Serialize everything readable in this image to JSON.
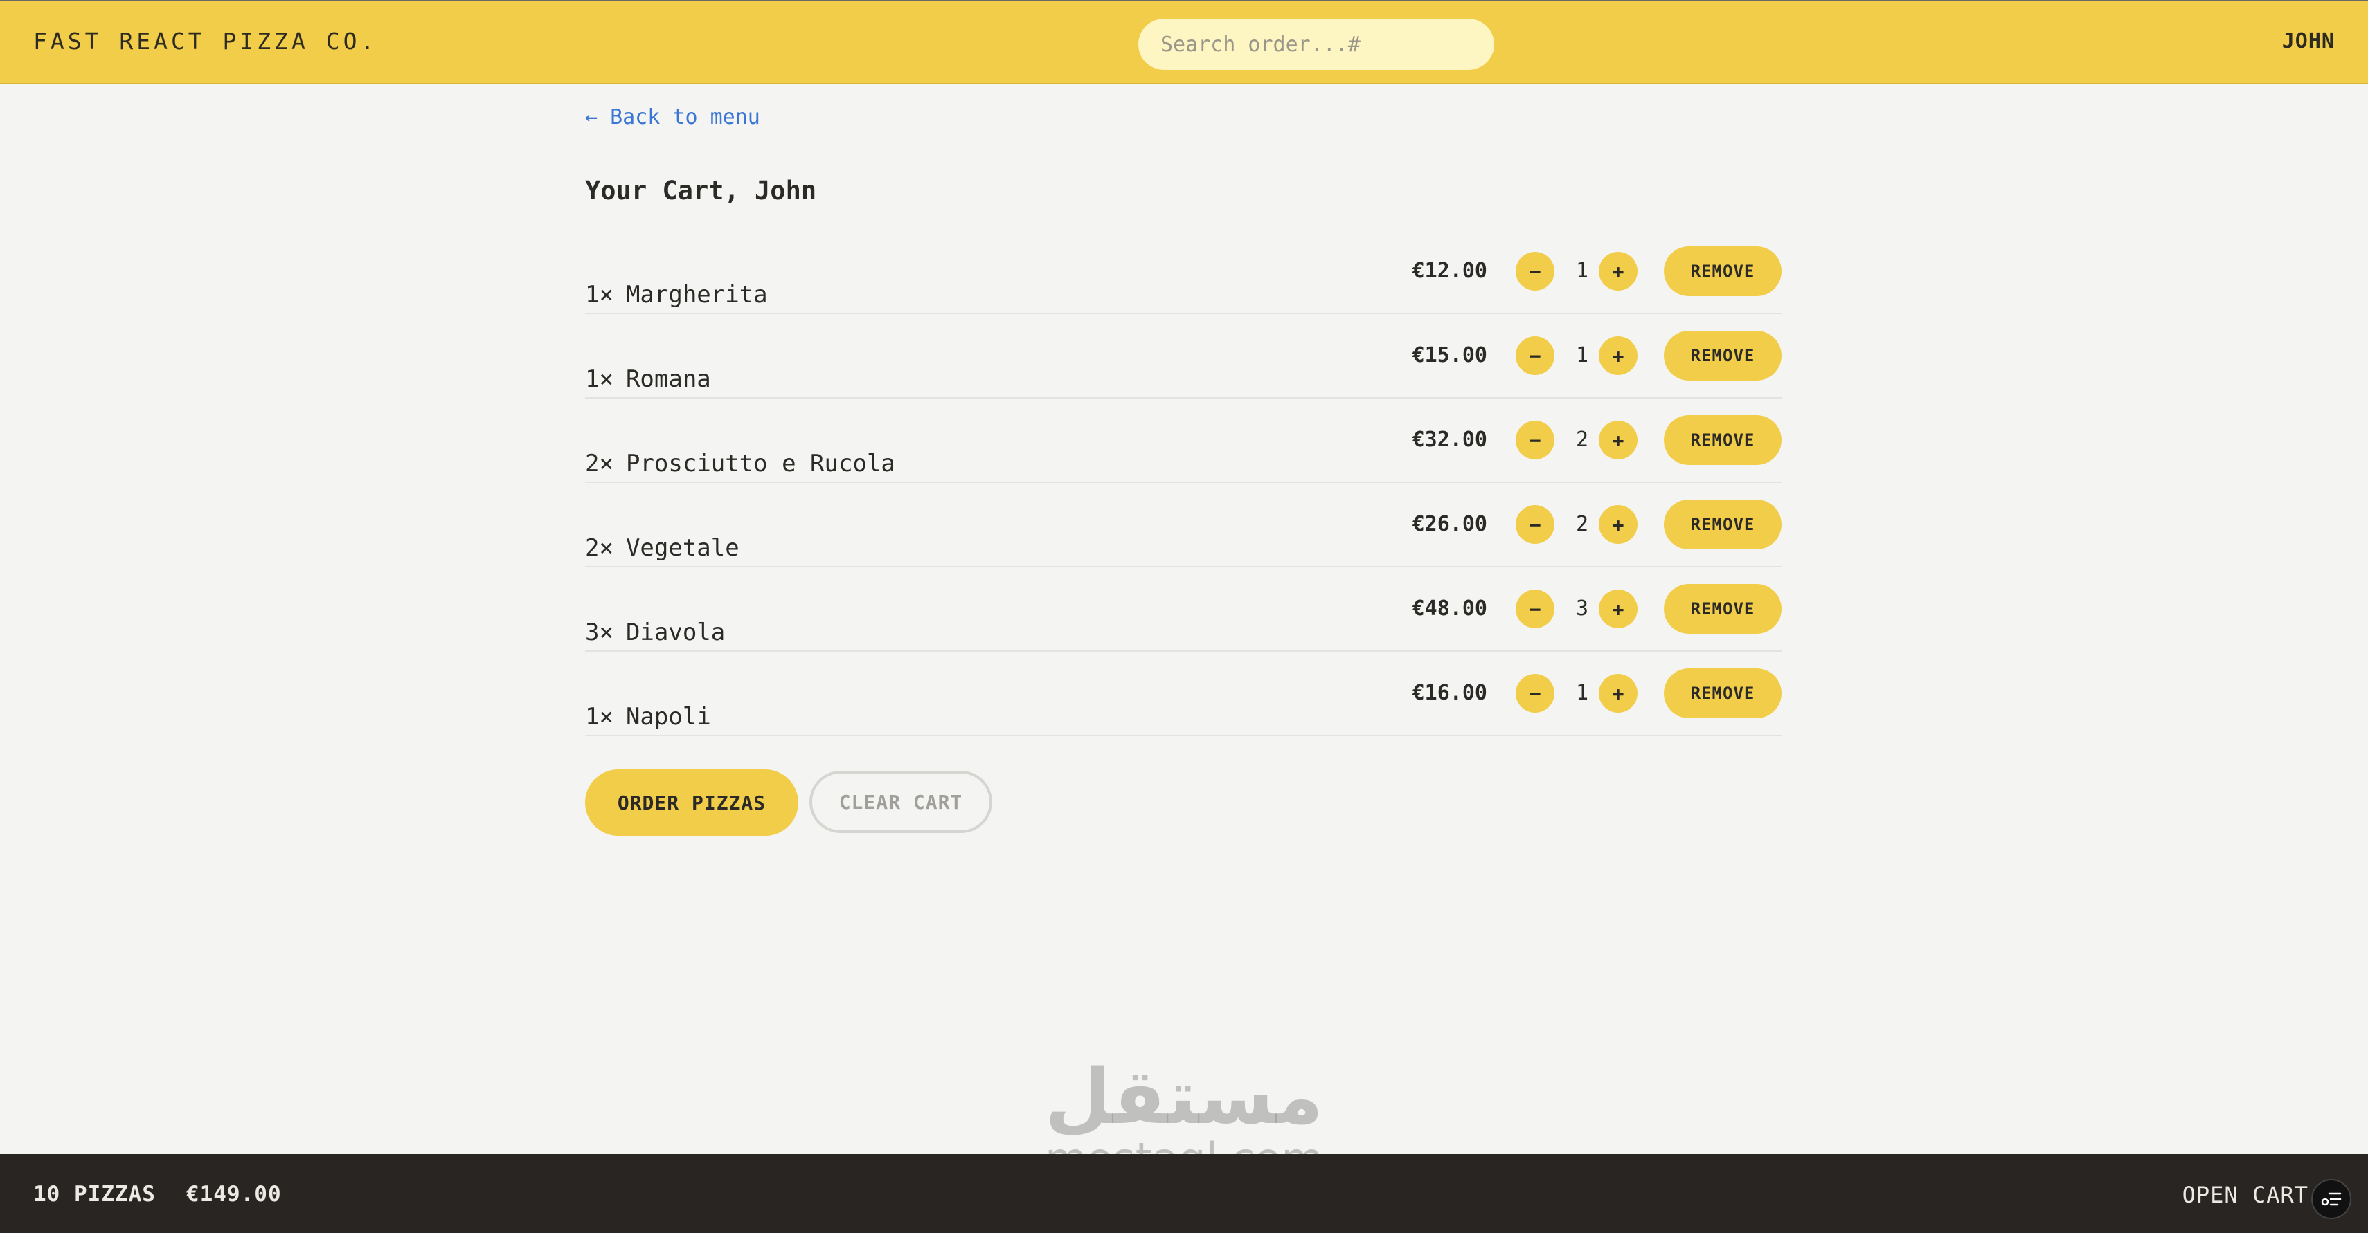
{
  "header": {
    "logo": "FAST REACT PIZZA CO.",
    "search_placeholder": "Search order...#",
    "username": "JOHN"
  },
  "main": {
    "back_link": "← Back to menu",
    "title": "Your Cart, John",
    "delete_label": "REMOVE",
    "minus_label": "−",
    "plus_label": "+",
    "items": [
      {
        "qty_label": "1×",
        "name": "Margherita",
        "price": "€12.00",
        "quantity": "1"
      },
      {
        "qty_label": "1×",
        "name": "Romana",
        "price": "€15.00",
        "quantity": "1"
      },
      {
        "qty_label": "2×",
        "name": "Prosciutto e Rucola",
        "price": "€32.00",
        "quantity": "2"
      },
      {
        "qty_label": "2×",
        "name": "Vegetale",
        "price": "€26.00",
        "quantity": "2"
      },
      {
        "qty_label": "3×",
        "name": "Diavola",
        "price": "€48.00",
        "quantity": "3"
      },
      {
        "qty_label": "1×",
        "name": "Napoli",
        "price": "€16.00",
        "quantity": "1"
      }
    ],
    "order_button": "ORDER PIZZAS",
    "clear_button": "CLEAR CART"
  },
  "footer": {
    "pizza_count": "10 PIZZAS",
    "total": "€149.00",
    "open_cart": "OPEN CART"
  },
  "watermark": {
    "arabic": "مستقل",
    "latin": "mostaql.com"
  },
  "colors": {
    "accent": "#f2cd49",
    "footer_bg": "#282523",
    "link": "#3b76d6"
  }
}
